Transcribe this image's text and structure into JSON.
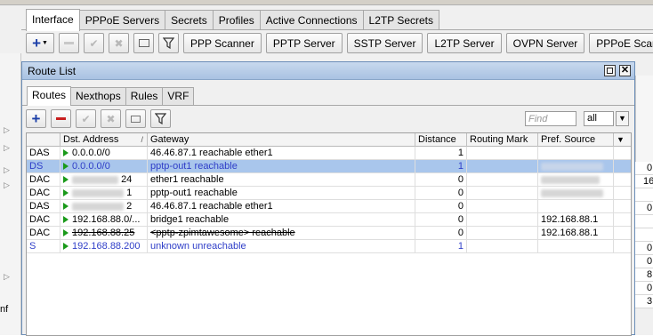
{
  "ppp_window": {
    "tabs": [
      {
        "label": "Interface",
        "active": true
      },
      {
        "label": "PPPoE Servers",
        "active": false
      },
      {
        "label": "Secrets",
        "active": false
      },
      {
        "label": "Profiles",
        "active": false
      },
      {
        "label": "Active Connections",
        "active": false
      },
      {
        "label": "L2TP Secrets",
        "active": false
      }
    ],
    "toolbar_buttons": [
      "PPP Scanner",
      "PPTP Server",
      "SSTP Server",
      "L2TP Server",
      "OVPN Server",
      "PPPoE Scan"
    ],
    "right_column_values": [
      "0",
      "16",
      "",
      "0",
      "",
      "",
      "0",
      "0",
      "8",
      "0",
      "3"
    ],
    "left_text": "nf"
  },
  "route_window": {
    "title": "Route List",
    "tabs": [
      {
        "label": "Routes",
        "active": true
      },
      {
        "label": "Nexthops",
        "active": false
      },
      {
        "label": "Rules",
        "active": false
      },
      {
        "label": "VRF",
        "active": false
      }
    ],
    "find_placeholder": "Find",
    "filter_value": "all",
    "columns": [
      "",
      "Dst. Address",
      "Gateway",
      "Distance",
      "Routing Mark",
      "Pref. Source"
    ],
    "rows": [
      {
        "flags": "DAS",
        "dst": "0.0.0.0/0",
        "gateway": "46.46.87.1 reachable ether1",
        "distance": "1",
        "mark": "",
        "pref": "",
        "selected": false,
        "blue": false
      },
      {
        "flags": "DS",
        "dst": "0.0.0.0/0",
        "gateway": "pptp-out1 reachable",
        "distance": "1",
        "mark": "",
        "pref": "",
        "selected": true,
        "blue": true
      },
      {
        "flags": "DAC",
        "dst": "24",
        "gateway": "ether1 reachable",
        "distance": "0",
        "mark": "",
        "pref": "",
        "selected": false,
        "blue": false
      },
      {
        "flags": "DAC",
        "dst": "1",
        "gateway": "pptp-out1 reachable",
        "distance": "0",
        "mark": "",
        "pref": "",
        "selected": false,
        "blue": false
      },
      {
        "flags": "DAS",
        "dst": "2",
        "gateway": "46.46.87.1 reachable ether1",
        "distance": "0",
        "mark": "",
        "pref": "",
        "selected": false,
        "blue": false
      },
      {
        "flags": "DAC",
        "dst": "192.168.88.0/...",
        "gateway": "bridge1 reachable",
        "distance": "0",
        "mark": "",
        "pref": "192.168.88.1",
        "selected": false,
        "blue": false
      },
      {
        "flags": "DAC",
        "dst": "192.168.88.25",
        "gateway": "<pptp-zpimtawesome> reachable",
        "distance": "0",
        "mark": "",
        "pref": "192.168.88.1",
        "selected": false,
        "blue": false
      },
      {
        "flags": "S",
        "dst": "192.168.88.200",
        "gateway": "unknown unreachable",
        "distance": "1",
        "mark": "",
        "pref": "",
        "selected": false,
        "blue": true
      }
    ]
  }
}
